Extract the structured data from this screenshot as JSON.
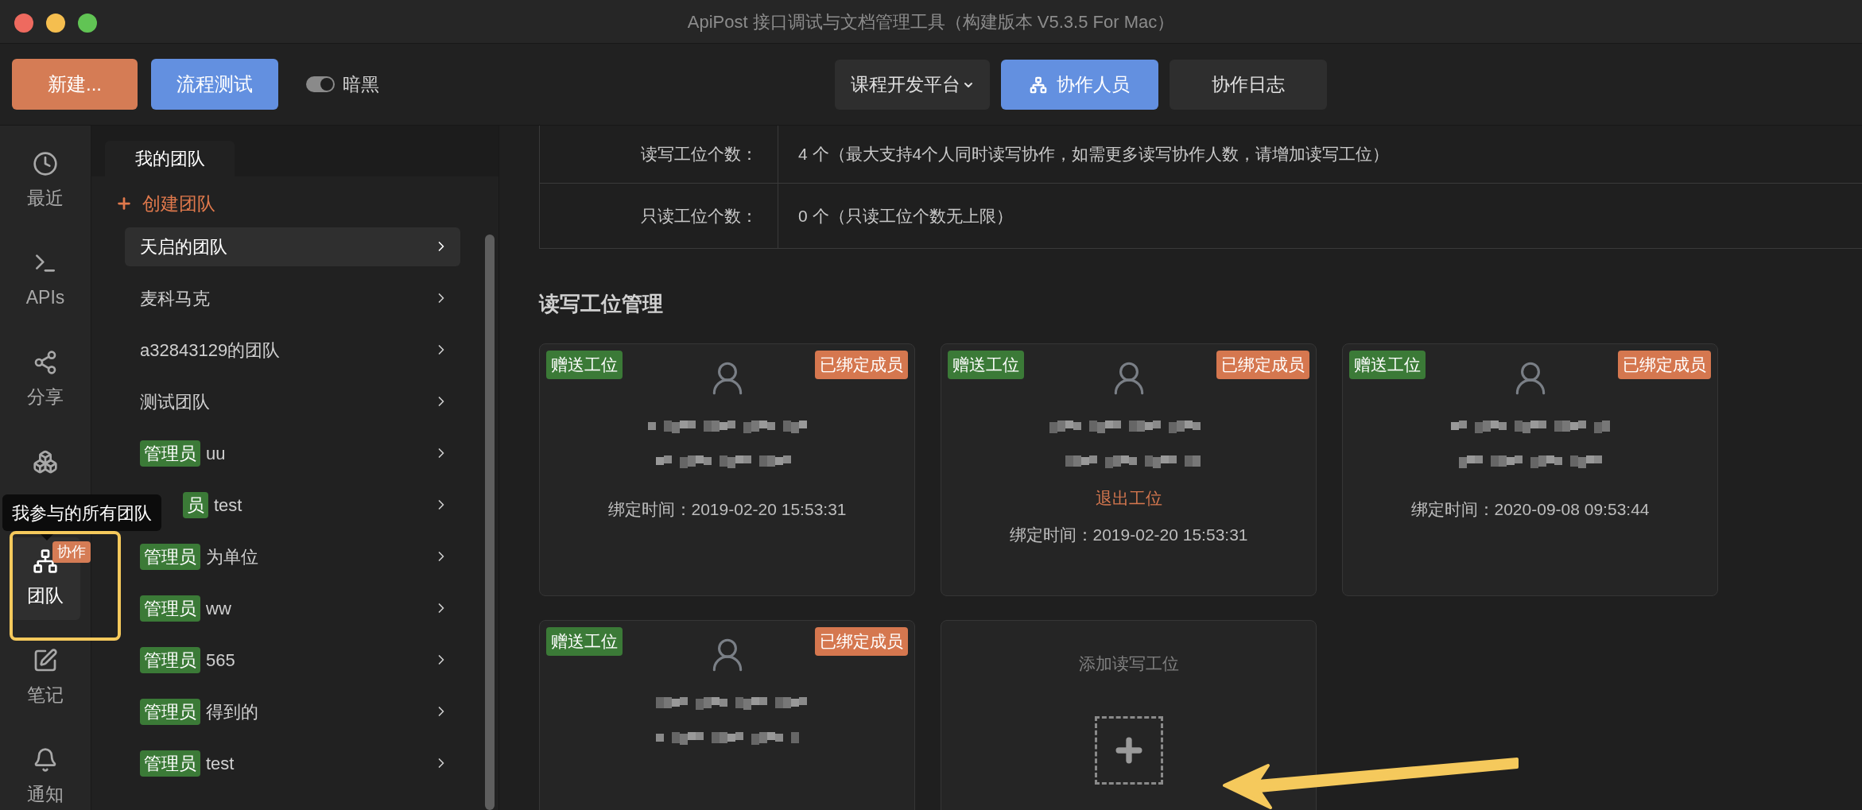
{
  "window": {
    "title": "ApiPost 接口调试与文档管理工具（构建版本 V5.3.5 For Mac）"
  },
  "toolbar": {
    "new_button": "新建...",
    "flow_button": "流程测试",
    "dark_toggle": {
      "label": "暗黑",
      "on": true
    },
    "project_select": "课程开发平台",
    "tabs": [
      {
        "label": "协作人员",
        "selected": true,
        "kind": "members"
      },
      {
        "label": "协作日志",
        "selected": false,
        "kind": "log"
      }
    ]
  },
  "sidebar": {
    "items": [
      {
        "kind": "clock",
        "label": "最近",
        "selected": false
      },
      {
        "kind": "terminal",
        "label": "APIs",
        "selected": false
      },
      {
        "kind": "share",
        "label": "分享",
        "selected": false
      },
      {
        "kind": "boxes",
        "selected": false
      },
      {
        "kind": "team",
        "label": "团队",
        "selected": true,
        "badge": "协作"
      },
      {
        "kind": "note",
        "label": "笔记",
        "selected": false
      },
      {
        "kind": "bell",
        "label": "通知",
        "selected": false
      }
    ]
  },
  "tooltip": "我参与的所有团队",
  "teams": {
    "tab": "我的团队",
    "create": "创建团队",
    "items": [
      {
        "name": "天启的团队",
        "selected": true
      },
      {
        "name": "麦科马克",
        "selected": false
      },
      {
        "name": "a32843129的团队",
        "selected": false
      },
      {
        "name": "测试团队",
        "selected": false
      },
      {
        "name": "uu",
        "badge": "管理员",
        "selected": false
      },
      {
        "name": "test",
        "badge": "员",
        "covered": true,
        "selected": false
      },
      {
        "name": "为单位",
        "badge": "管理员",
        "selected": false
      },
      {
        "name": "ww",
        "badge": "管理员",
        "selected": false
      },
      {
        "name": "565",
        "badge": "管理员",
        "selected": false
      },
      {
        "name": "得到的",
        "badge": "管理员",
        "selected": false
      },
      {
        "name": "test",
        "badge": "管理员",
        "selected": false
      }
    ]
  },
  "info_rows": [
    {
      "label": "读写工位个数：",
      "value": "4 个（最大支持4个人同时读写协作，如需更多读写协作人数，请增加读写工位）"
    },
    {
      "label": "只读工位个数：",
      "value": "0 个（只读工位个数无上限）"
    }
  ],
  "section_title": "读写工位管理",
  "seats": [
    {
      "kind": "member",
      "gift_tag": "赠送工位",
      "status_tag": "已绑定成员",
      "bound_time": "绑定时间：2019-02-20 15:53:31"
    },
    {
      "kind": "member",
      "gift_tag": "赠送工位",
      "status_tag": "已绑定成员",
      "action": "退出工位",
      "bound_time": "绑定时间：2019-02-20 15:53:31"
    },
    {
      "kind": "member",
      "gift_tag": "赠送工位",
      "status_tag": "已绑定成员",
      "bound_time": "绑定时间：2020-09-08 09:53:44"
    },
    {
      "kind": "member",
      "gift_tag": "赠送工位",
      "status_tag": "已绑定成员"
    },
    {
      "kind": "add",
      "label": "添加读写工位"
    }
  ]
}
